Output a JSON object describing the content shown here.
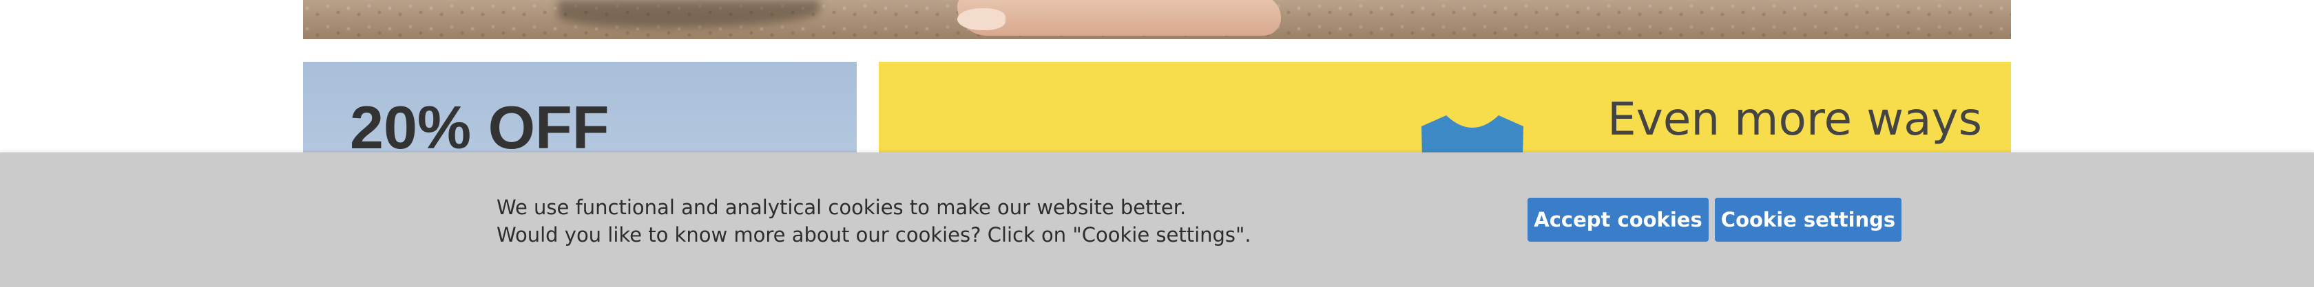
{
  "promo_left": {
    "headline": "20% OFF"
  },
  "promo_right": {
    "tagline": "Even more ways"
  },
  "cookie_banner": {
    "line1": "We use functional and analytical cookies to make our website better.",
    "line2": "Would you like to know more about our cookies? Click on \"Cookie settings\".",
    "accept_label": "Accept cookies",
    "settings_label": "Cookie settings"
  },
  "colors": {
    "banner_bg": "#cbcbcb",
    "button_bg": "#3a7dc9",
    "button_text": "#ffffff",
    "promo_right_bg": "#f7dc4c"
  }
}
